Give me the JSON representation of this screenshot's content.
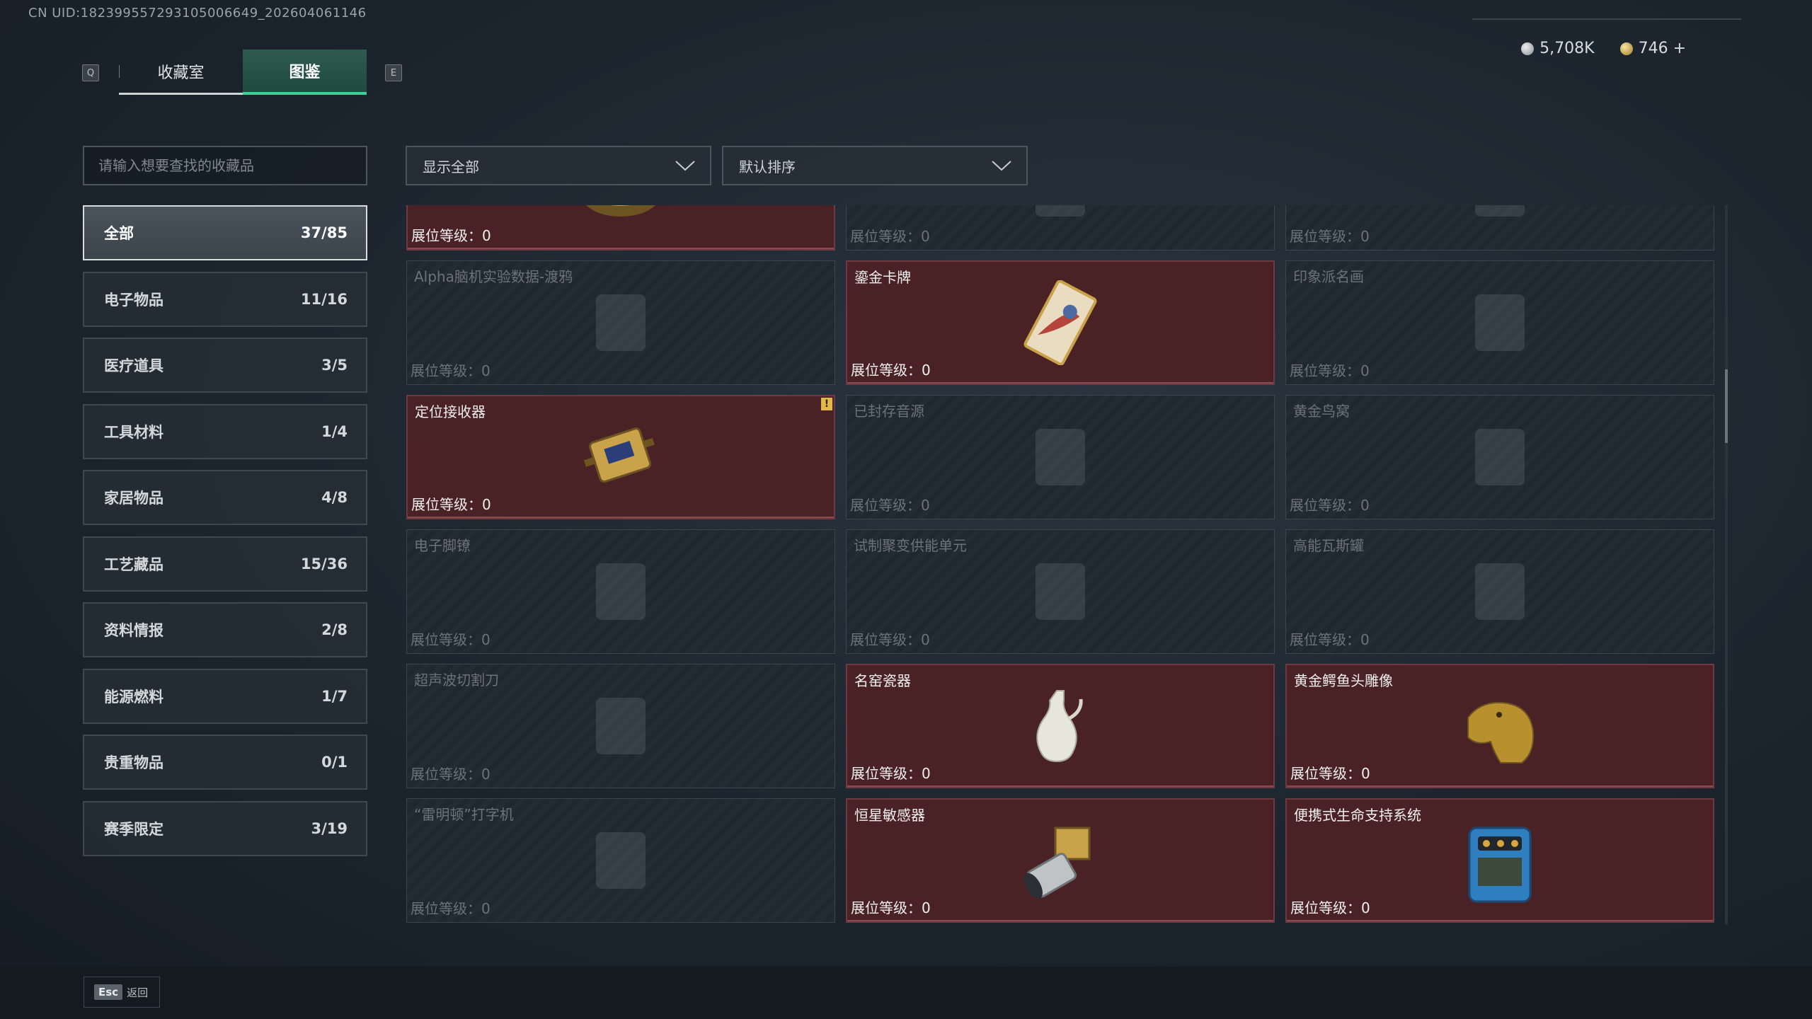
{
  "uid": "CN UID:1823995572931050066​49_202604061146",
  "tabs": {
    "left_key": "Q",
    "right_key": "E",
    "items": [
      {
        "label": "收藏室",
        "active": false
      },
      {
        "label": "图鉴",
        "active": true
      }
    ]
  },
  "currency": [
    {
      "icon": "silver-coin-icon",
      "value": "5,708K"
    },
    {
      "icon": "gold-coin-icon",
      "value": "746 +"
    }
  ],
  "search": {
    "placeholder": "请输入想要查找的收藏品"
  },
  "filter": {
    "value": "显示全部"
  },
  "sort": {
    "value": "默认排序"
  },
  "categories": [
    {
      "label": "全部",
      "count": "37/85",
      "active": true
    },
    {
      "label": "电子物品",
      "count": "11/16"
    },
    {
      "label": "医疗道具",
      "count": "3/5"
    },
    {
      "label": "工具材料",
      "count": "1/4"
    },
    {
      "label": "家居物品",
      "count": "4/8"
    },
    {
      "label": "工艺藏品",
      "count": "15/36"
    },
    {
      "label": "资料情报",
      "count": "2/8"
    },
    {
      "label": "能源燃料",
      "count": "1/7"
    },
    {
      "label": "贵重物品",
      "count": "0/1"
    },
    {
      "label": "赛季限定",
      "count": "3/19"
    }
  ],
  "level_label": "展位等级：0",
  "items": [
    {
      "name": "",
      "owned": true,
      "icon": "caviar-tin-icon"
    },
    {
      "name": "",
      "owned": false,
      "icon": "item-silhouette-icon"
    },
    {
      "name": "",
      "owned": false,
      "icon": "item-silhouette-icon"
    },
    {
      "name": "Alpha脑机实验数据-渡鸦",
      "owned": false,
      "icon": "drive-icon"
    },
    {
      "name": "鎏金卡牌",
      "owned": true,
      "icon": "gilded-card-icon"
    },
    {
      "name": "印象派名画",
      "owned": false,
      "icon": "painting-icon"
    },
    {
      "name": "定位接收器",
      "owned": true,
      "icon": "receiver-icon",
      "warning": "!"
    },
    {
      "name": "已封存音源",
      "owned": false,
      "icon": "audio-source-icon"
    },
    {
      "name": "黄金鸟窝",
      "owned": false,
      "icon": "nest-icon"
    },
    {
      "name": "电子脚镣",
      "owned": false,
      "icon": "shackle-icon"
    },
    {
      "name": "试制聚变供能单元",
      "owned": false,
      "icon": "fusion-unit-icon"
    },
    {
      "name": "高能瓦斯罐",
      "owned": false,
      "icon": "gas-tank-icon"
    },
    {
      "name": "超声波切割刀",
      "owned": false,
      "icon": "cutter-icon"
    },
    {
      "name": "名窑瓷器",
      "owned": true,
      "icon": "porcelain-vase-icon"
    },
    {
      "name": "黄金鳄鱼头雕像",
      "owned": true,
      "icon": "crocodile-statue-icon"
    },
    {
      "name": "“雷明顿”打字机",
      "owned": false,
      "icon": "typewriter-icon"
    },
    {
      "name": "恒星敏感器",
      "owned": true,
      "icon": "star-sensor-icon"
    },
    {
      "name": "便携式生命支持系统",
      "owned": true,
      "icon": "life-support-icon"
    }
  ],
  "footer": {
    "key": "Esc",
    "label": "返回"
  }
}
